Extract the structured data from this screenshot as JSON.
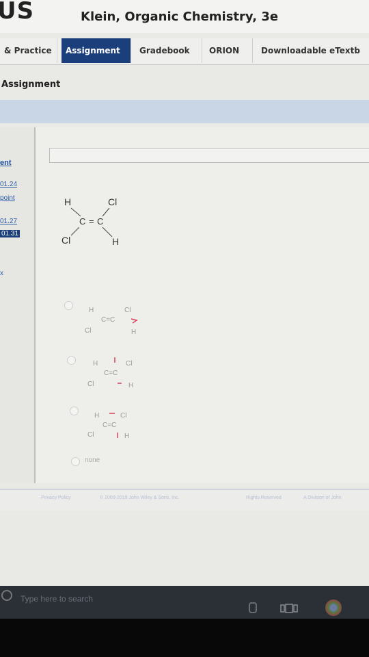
{
  "header": {
    "logo": "US",
    "course_title": "Klein, Organic Chemistry, 3e"
  },
  "nav": {
    "tabs": [
      {
        "label": "& Practice"
      },
      {
        "label": "Assignment"
      },
      {
        "label": "Gradebook"
      },
      {
        "label": "ORION"
      },
      {
        "label": "Downloadable eTextb"
      }
    ]
  },
  "page": {
    "section_title": "Assignment"
  },
  "sidebar": {
    "header": "ent",
    "links": [
      "01.24",
      "point",
      "01.27",
      "01.31"
    ],
    "marker": "x"
  },
  "question": {
    "structure": {
      "h1": "H",
      "cl1": "Cl",
      "c1": "C",
      "bond": "=",
      "c2": "C",
      "cl2": "Cl",
      "h2": "H"
    },
    "options": [
      {
        "top_left": "H",
        "top_right": "Cl",
        "bottom_left": "Cl",
        "bottom_right": "H",
        "center": "C=C"
      },
      {
        "top_left": "H",
        "top_right": "Cl",
        "bottom_left": "Cl",
        "bottom_right": "H",
        "center": "C=C"
      },
      {
        "top_left": "H",
        "top_right": "Cl",
        "bottom_left": "Cl",
        "bottom_right": "H",
        "center": "C=C"
      }
    ],
    "none_label": "none"
  },
  "footer": {
    "links": [
      "Privacy Policy",
      "© 2000-2019 John Wiley & Sons, Inc.",
      "Rights Reserved",
      "A Division of John"
    ]
  },
  "taskbar": {
    "search_placeholder": "Type here to search"
  },
  "colors": {
    "nav_active": "#1a3f7a",
    "link": "#2a5ca8",
    "arrow": "#d8435a"
  }
}
